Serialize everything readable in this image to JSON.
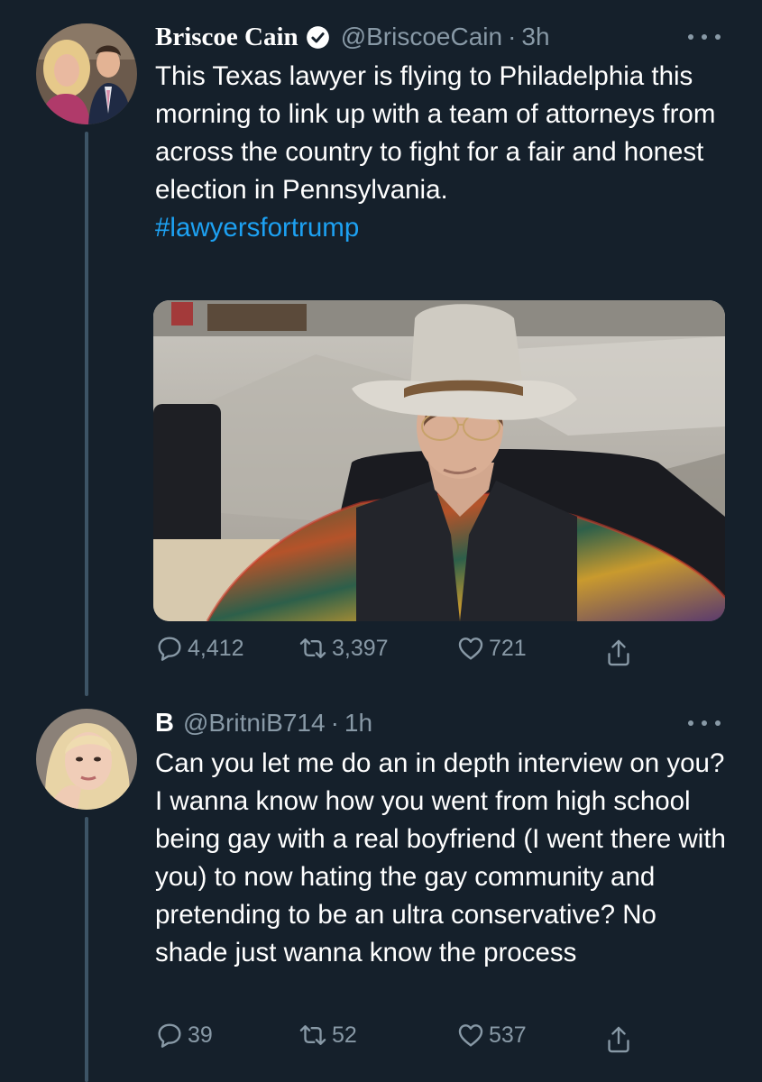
{
  "tweets": [
    {
      "display_name": "Briscoe Cain",
      "verified": true,
      "handle": "@BriscoeCain",
      "separator": "·",
      "time": "3h",
      "text": "This Texas lawyer is flying to Philadelphia this morning to link up with a team of attorneys from across the country to fight for a fair and honest election in Pennsylvania.",
      "hashtag": "#lawyersfortrump",
      "media": "photo of a man in a white cowboy hat, glasses, black vest and colorful striped sweater seated in an airport terminal",
      "replies": "4,412",
      "retweets": "3,397",
      "likes": "721"
    },
    {
      "display_name": "B",
      "handle": "@BritniB714",
      "separator": "·",
      "time": "1h",
      "text": "Can you let me do an in depth interview on you? I wanna know how you went from high school being gay with a real boyfriend (I went there with you) to now hating the gay community and pretending to be an ultra conservative? No shade just wanna know the process",
      "replies": "39",
      "retweets": "52",
      "likes": "537"
    }
  ],
  "icons": [
    "reply-icon",
    "retweet-icon",
    "like-icon",
    "share-icon",
    "more-icon",
    "verified-badge-icon"
  ],
  "colors": {
    "background": "#15202b",
    "text": "#ffffff",
    "secondary": "#8899a6",
    "accent": "#1da1f2",
    "thread_line": "#3d5466"
  }
}
